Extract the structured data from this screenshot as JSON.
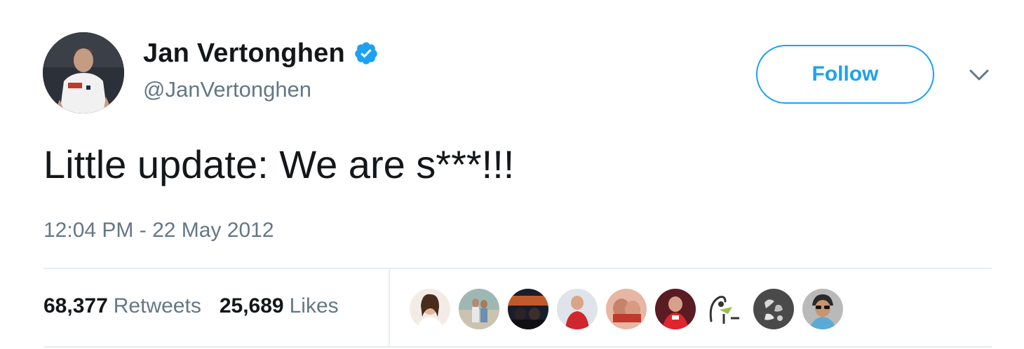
{
  "user": {
    "display_name": "Jan Vertonghen",
    "handle": "@JanVertonghen",
    "verified": true,
    "avatar_icon": "profile-photo"
  },
  "actions": {
    "follow_label": "Follow",
    "more_icon": "chevron-down-icon"
  },
  "tweet": {
    "text": "Little update: We are s***!!!",
    "timestamp": "12:04 PM - 22 May 2012"
  },
  "stats": {
    "retweets_count": "68,377",
    "retweets_label": "Retweets",
    "likes_count": "25,689",
    "likes_label": "Likes"
  },
  "likers": [
    {
      "icon": "liker-avatar-1"
    },
    {
      "icon": "liker-avatar-2"
    },
    {
      "icon": "liker-avatar-3"
    },
    {
      "icon": "liker-avatar-4"
    },
    {
      "icon": "liker-avatar-5"
    },
    {
      "icon": "liker-avatar-6"
    },
    {
      "icon": "liker-avatar-7"
    },
    {
      "icon": "liker-avatar-8"
    },
    {
      "icon": "liker-avatar-9"
    }
  ],
  "colors": {
    "accent": "#1da1f2",
    "text_primary": "#14171a",
    "text_secondary": "#657786",
    "divider": "#e6ecf0"
  }
}
